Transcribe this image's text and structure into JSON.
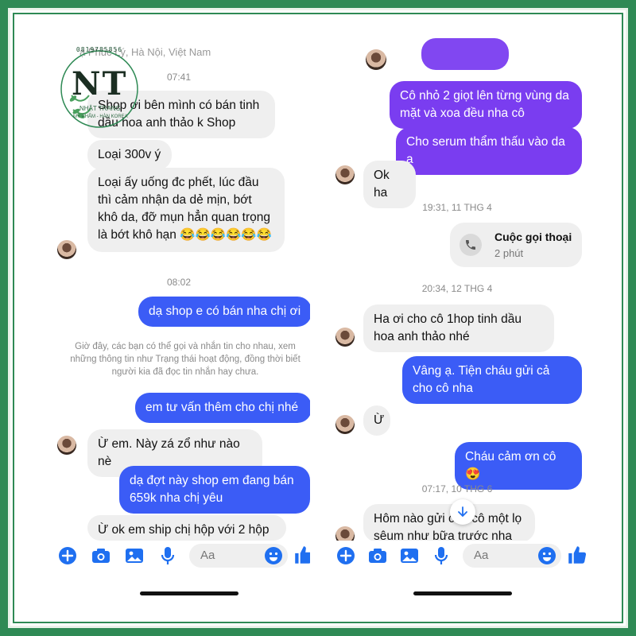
{
  "left": {
    "partial_header": "ạ Phúc Lý, Hà Nội, Việt Nam",
    "time1": "07:41",
    "messages1": [
      "Shop ơi bên mình có bán tinh dầu hoa anh thảo k Shop",
      "Loại 300v ý",
      "Loại ấy uống đc phết, lúc đầu thì cảm nhận da dẻ mịn, bớt khô da, đỡ mụn hẳn quan trọng là bớt khô hạn 😂😂😂😂😂😂"
    ],
    "time2": "08:02",
    "reply1": "dạ shop e có bán nha chị ơi",
    "system_note": "Giờ đây, các bạn có thể gọi và nhắn tin cho nhau, xem những thông tin như Trạng thái hoạt động, đồng thời biết người kia đã đọc tin nhắn hay chưa.",
    "reply2": "em tư vấn thêm cho chị nhé",
    "incoming2": "Ừ em. Này zá zổ như nào nè",
    "reply3": "dạ đợt này shop em đang bán 659k nha chị yêu",
    "incoming3": "Ừ ok em ship chị hộp với 2 hộp",
    "input_placeholder": "Aa"
  },
  "right": {
    "out1": "Cô nhỏ 2 giọt lên từng vùng da mặt và xoa đều nha cô",
    "out2": "Cho serum thẩm thấu vào da ạ",
    "in1": "Ok ha",
    "time1": "19:31, 11 THG 4",
    "call_title": "Cuộc gọi thoại",
    "call_duration": "2 phút",
    "time2": "20:34, 12 THG 4",
    "in2": "Ha ơi cho cô 1hop tinh dầu hoa anh thảo nhé",
    "out3": "Vâng ạ. Tiện cháu gửi cả cho cô nha",
    "in3": "Ừ",
    "out4": "Cháu cảm ơn cô 😍",
    "time3": "07:17, 10 THG 6",
    "in4": "Hôm nào gửi cho cô một lọ sêum như bữa trước nha",
    "input_placeholder": "Aa"
  },
  "logo": {
    "letters": "NT",
    "name": "NHẬT TRANG",
    "tagline": "MỸ PHẨM - HÀN KOREA",
    "top_text": "0819785856"
  },
  "colors": {
    "frame": "#2f8a55",
    "outgoing_blue": "#3b5cf6",
    "outgoing_purple": "#7a3df0",
    "incoming": "#efefef",
    "icon_blue": "#1f6ff0"
  },
  "icons": [
    "plus-icon",
    "camera-icon",
    "image-icon",
    "microphone-icon",
    "emoji-icon",
    "thumbs-up-icon",
    "phone-icon",
    "scroll-down-icon"
  ]
}
